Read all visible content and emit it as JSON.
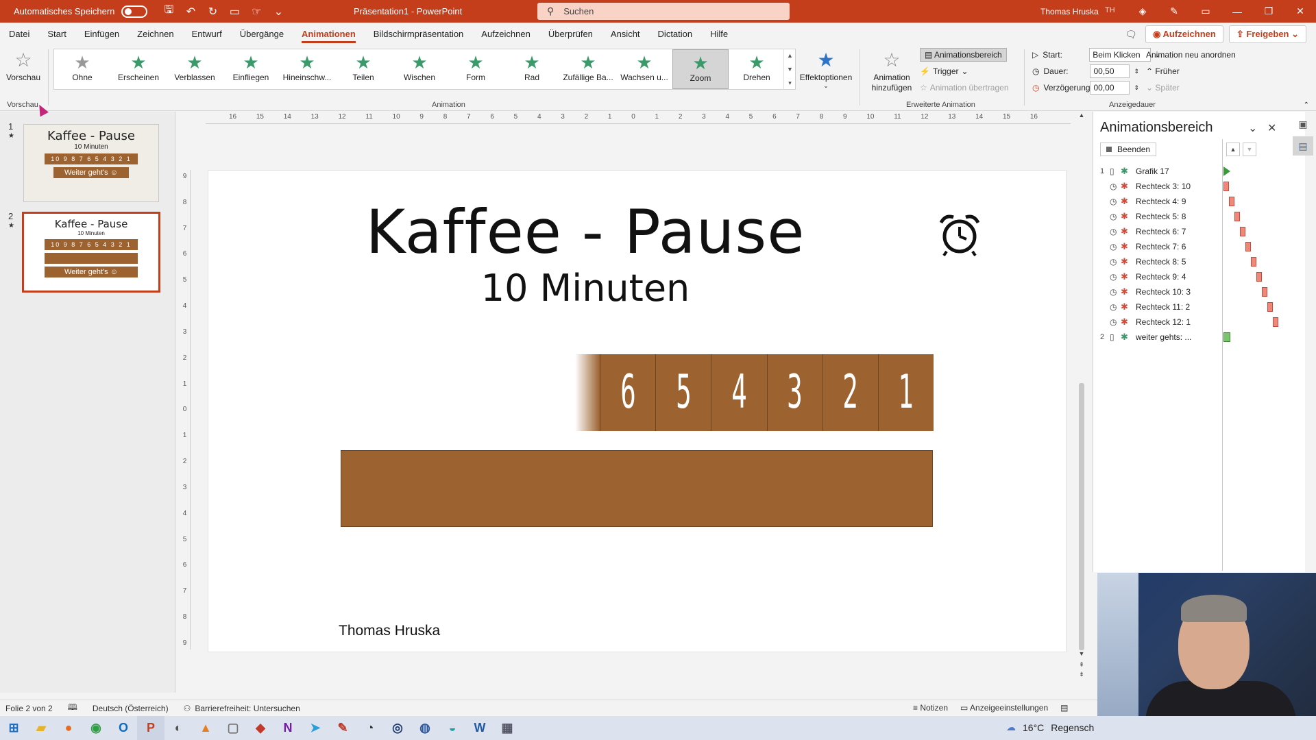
{
  "titlebar": {
    "autosave_label": "Automatisches Speichern",
    "doc_title": "Präsentation1  -  PowerPoint",
    "search_placeholder": "Suchen",
    "user_name": "Thomas Hruska",
    "user_initials": "TH",
    "accent": "#c43e1c"
  },
  "ribbon_tabs": [
    "Datei",
    "Start",
    "Einfügen",
    "Zeichnen",
    "Entwurf",
    "Übergänge",
    "Animationen",
    "Bildschirmpräsentation",
    "Aufzeichnen",
    "Überprüfen",
    "Ansicht",
    "Dictation",
    "Hilfe"
  ],
  "active_tab": "Animationen",
  "tab_actions": {
    "record": "Aufzeichnen",
    "share": "Freigeben"
  },
  "ribbon": {
    "preview": {
      "label": "Vorschau",
      "group": "Vorschau"
    },
    "animation_group": "Animation",
    "animations": [
      {
        "label": "Ohne"
      },
      {
        "label": "Erscheinen"
      },
      {
        "label": "Verblassen"
      },
      {
        "label": "Einfliegen"
      },
      {
        "label": "Hineinschw..."
      },
      {
        "label": "Teilen"
      },
      {
        "label": "Wischen"
      },
      {
        "label": "Form"
      },
      {
        "label": "Rad"
      },
      {
        "label": "Zufällige Ba..."
      },
      {
        "label": "Wachsen u..."
      },
      {
        "label": "Zoom"
      },
      {
        "label": "Drehen"
      }
    ],
    "selected_animation": "Zoom",
    "effect_options": "Effektoptionen",
    "add_animation": "Animation hinzufügen",
    "advanced_group": "Erweiterte Animation",
    "animation_pane_btn": "Animationsbereich",
    "trigger": "Trigger",
    "copy_animation": "Animation übertragen",
    "timing_group": "Anzeigedauer",
    "start_label": "Start:",
    "start_value": "Beim Klicken",
    "duration_label": "Dauer:",
    "duration_value": "00,50",
    "delay_label": "Verzögerung:",
    "delay_value": "00,00",
    "reorder_title": "Animation neu anordnen",
    "earlier": "Früher",
    "later": "Später"
  },
  "ruler": {
    "h_numbers": [
      "16",
      "15",
      "14",
      "13",
      "12",
      "11",
      "10",
      "9",
      "8",
      "7",
      "6",
      "5",
      "4",
      "3",
      "2",
      "1",
      "0",
      "1",
      "2",
      "3",
      "4",
      "5",
      "6",
      "7",
      "8",
      "9",
      "10",
      "11",
      "12",
      "13",
      "14",
      "15",
      "16"
    ],
    "v_numbers": [
      "9",
      "8",
      "7",
      "6",
      "5",
      "4",
      "3",
      "2",
      "1",
      "0",
      "1",
      "2",
      "3",
      "4",
      "5",
      "6",
      "7",
      "8",
      "9"
    ]
  },
  "thumbnails": [
    {
      "num": "1",
      "title": "Kaffee - Pause",
      "sub": "10 Minuten",
      "bar": "10 9 8 7 6 5 4 3 2 1",
      "bar2": "Weiter geht's ☺"
    },
    {
      "num": "2",
      "title": "Kaffee - Pause",
      "sub": "10 Minuten",
      "bar": "10 9 8 7 6 5 4 3 2 1",
      "bar2": "Weiter geht's ☺"
    }
  ],
  "slide": {
    "title": "Kaffee - Pause",
    "subtitle": "10 Minuten",
    "countdown": [
      "6",
      "5",
      "4",
      "3",
      "2",
      "1"
    ],
    "author": "Thomas Hruska",
    "brown": "#9c6331"
  },
  "animation_pane": {
    "title": "Animationsbereich",
    "play_btn": "Beenden",
    "items": [
      {
        "num": "1",
        "name": "Grafik 17",
        "kind": "green",
        "tl": "play",
        "offset": 0
      },
      {
        "num": "",
        "name": "Rechteck 3: 10",
        "kind": "red",
        "tl": "red",
        "offset": 0
      },
      {
        "num": "",
        "name": "Rechteck 4: 9",
        "kind": "red",
        "tl": "red",
        "offset": 1
      },
      {
        "num": "",
        "name": "Rechteck 5: 8",
        "kind": "red",
        "tl": "red",
        "offset": 2
      },
      {
        "num": "",
        "name": "Rechteck 6: 7",
        "kind": "red",
        "tl": "red",
        "offset": 3
      },
      {
        "num": "",
        "name": "Rechteck 7: 6",
        "kind": "red",
        "tl": "red",
        "offset": 4
      },
      {
        "num": "",
        "name": "Rechteck 8: 5",
        "kind": "red",
        "tl": "red",
        "offset": 5
      },
      {
        "num": "",
        "name": "Rechteck 9: 4",
        "kind": "red",
        "tl": "red",
        "offset": 6
      },
      {
        "num": "",
        "name": "Rechteck 10: 3",
        "kind": "red",
        "tl": "red",
        "offset": 7
      },
      {
        "num": "",
        "name": "Rechteck 11: 2",
        "kind": "red",
        "tl": "red",
        "offset": 8
      },
      {
        "num": "",
        "name": "Rechteck 12: 1",
        "kind": "red",
        "tl": "red",
        "offset": 9
      },
      {
        "num": "2",
        "name": "weiter gehts: ...",
        "kind": "green",
        "tl": "green",
        "offset": 0
      }
    ]
  },
  "statusbar": {
    "slide_info": "Folie 2 von 2",
    "language": "Deutsch (Österreich)",
    "accessibility": "Barrierefreiheit: Untersuchen",
    "notes": "Notizen",
    "display_settings": "Anzeigeeinstellungen"
  },
  "taskbar": {
    "weather_temp": "16°C",
    "weather_text": "Regensch"
  }
}
